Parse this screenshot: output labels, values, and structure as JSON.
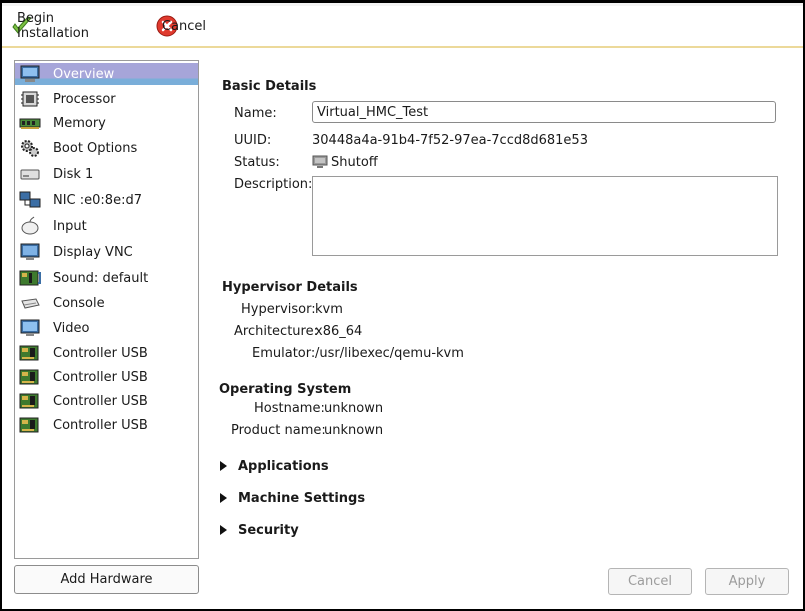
{
  "toolbar": {
    "begin_label": "Begin Installation",
    "cancel_label": "Cancel"
  },
  "sidebar": {
    "items": [
      {
        "label": "Overview",
        "icon": "monitor-icon"
      },
      {
        "label": "Processor",
        "icon": "processor-icon"
      },
      {
        "label": "Memory",
        "icon": "memory-icon"
      },
      {
        "label": "Boot Options",
        "icon": "gears-icon"
      },
      {
        "label": "Disk 1",
        "icon": "disk-icon"
      },
      {
        "label": "NIC :e0:8e:d7",
        "icon": "network-icon"
      },
      {
        "label": "Input",
        "icon": "mouse-icon"
      },
      {
        "label": "Display VNC",
        "icon": "display-icon"
      },
      {
        "label": "Sound: default",
        "icon": "sound-card-icon"
      },
      {
        "label": "Console",
        "icon": "console-icon"
      },
      {
        "label": "Video",
        "icon": "video-icon"
      },
      {
        "label": "Controller USB",
        "icon": "controller-card-icon"
      },
      {
        "label": "Controller USB",
        "icon": "controller-card-icon"
      },
      {
        "label": "Controller USB",
        "icon": "controller-card-icon"
      },
      {
        "label": "Controller USB",
        "icon": "controller-card-icon"
      }
    ],
    "selected": "Overview",
    "add_hardware_label": "Add Hardware"
  },
  "basic": {
    "title": "Basic Details",
    "name_label": "Name:",
    "name_value": "Virtual_HMC_Test",
    "uuid_label": "UUID:",
    "uuid_value": "30448a4a-91b4-7f52-97ea-7ccd8d681e53",
    "status_label": "Status:",
    "status_value": "Shutoff",
    "description_label": "Description:",
    "description_value": ""
  },
  "hypervisor": {
    "title": "Hypervisor Details",
    "hypervisor_label": "Hypervisor:",
    "hypervisor_value": "kvm",
    "arch_label": "Architecture:",
    "arch_value": "x86_64",
    "emulator_label": "Emulator:",
    "emulator_value": "/usr/libexec/qemu-kvm"
  },
  "os": {
    "title": "Operating System",
    "hostname_label": "Hostname:",
    "hostname_value": "unknown",
    "product_label": "Product name:",
    "product_value": "unknown"
  },
  "expanders": {
    "applications": "Applications",
    "machine_settings": "Machine Settings",
    "security": "Security"
  },
  "footer": {
    "cancel_label": "Cancel",
    "apply_label": "Apply"
  },
  "colors": {
    "selection": "#a6a5d9",
    "toolbar_border": "#ecd99a"
  }
}
